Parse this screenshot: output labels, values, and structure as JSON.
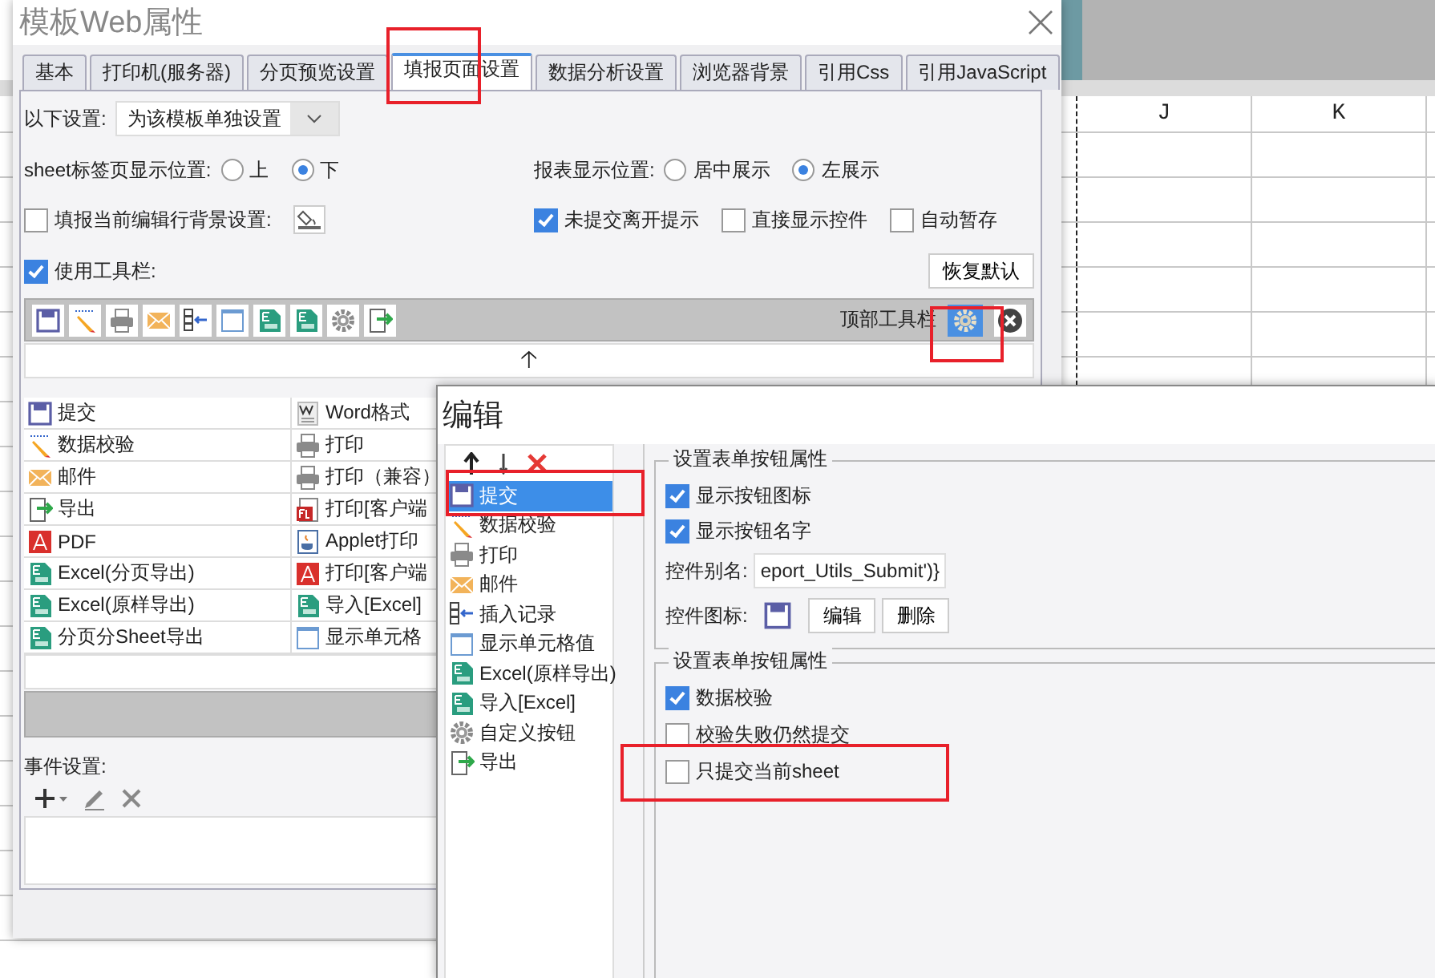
{
  "spreadsheet": {
    "columns": [
      "J",
      "K"
    ]
  },
  "main_dialog": {
    "title": "模板Web属性",
    "tabs": [
      {
        "label": "基本",
        "selected": false
      },
      {
        "label": "打印机(服务器)",
        "selected": false
      },
      {
        "label": "分页预览设置",
        "selected": false
      },
      {
        "label": "填报页面设置",
        "selected": true
      },
      {
        "label": "数据分析设置",
        "selected": false
      },
      {
        "label": "浏览器背景",
        "selected": false
      },
      {
        "label": "引用Css",
        "selected": false
      },
      {
        "label": "引用JavaScript",
        "selected": false
      }
    ],
    "scope": {
      "label": "以下设置:",
      "value": "为该模板单独设置"
    },
    "sheet_tab_position": {
      "label": "sheet标签页显示位置:",
      "options": [
        {
          "label": "上",
          "selected": false
        },
        {
          "label": "下",
          "selected": true
        }
      ]
    },
    "report_position": {
      "label": "报表显示位置:",
      "options": [
        {
          "label": "居中展示",
          "selected": false
        },
        {
          "label": "左展示",
          "selected": true
        }
      ]
    },
    "row_background": {
      "label": "填报当前编辑行背景设置:",
      "checked": false
    },
    "options": [
      {
        "label": "未提交离开提示",
        "checked": true
      },
      {
        "label": "直接显示控件",
        "checked": false
      },
      {
        "label": "自动暂存",
        "checked": false
      }
    ],
    "use_toolbar": {
      "label": "使用工具栏:",
      "checked": true
    },
    "restore_button": "恢复默认",
    "toolbar": {
      "icons": [
        {
          "kind": "save"
        },
        {
          "kind": "pencil"
        },
        {
          "kind": "print"
        },
        {
          "kind": "mail"
        },
        {
          "kind": "insert"
        },
        {
          "kind": "cell"
        },
        {
          "kind": "excel"
        },
        {
          "kind": "excel"
        },
        {
          "kind": "gear"
        },
        {
          "kind": "export"
        }
      ],
      "label": "顶部工具栏",
      "settings_selected": true
    },
    "arrow": "🡡",
    "buttons_left": [
      {
        "label": "提交",
        "kind": "save"
      },
      {
        "label": "数据校验",
        "kind": "pencil"
      },
      {
        "label": "邮件",
        "kind": "mail"
      },
      {
        "label": "导出",
        "kind": "export"
      },
      {
        "label": "PDF",
        "kind": "pdf"
      },
      {
        "label": "Excel(分页导出)",
        "kind": "excel"
      },
      {
        "label": "Excel(原样导出)",
        "kind": "excel"
      },
      {
        "label": "分页分Sheet导出",
        "kind": "excel"
      }
    ],
    "buttons_right": [
      {
        "label": "Word格式",
        "kind": "word"
      },
      {
        "label": "打印",
        "kind": "print"
      },
      {
        "label": "打印（兼容）",
        "kind": "print"
      },
      {
        "label": "打印[客户端",
        "kind": "flash"
      },
      {
        "label": "Applet打印",
        "kind": "applet"
      },
      {
        "label": "打印[客户端",
        "kind": "pdf"
      },
      {
        "label": "导入[Excel]",
        "kind": "excel"
      },
      {
        "label": "显示单元格",
        "kind": "cell"
      }
    ],
    "event_settings": "事件设置:"
  },
  "edit_dialog": {
    "title": "编辑",
    "list": [
      {
        "label": "提交",
        "kind": "save",
        "selected": true
      },
      {
        "label": "数据校验",
        "kind": "pencil",
        "selected": false
      },
      {
        "label": "打印",
        "kind": "print",
        "selected": false
      },
      {
        "label": "邮件",
        "kind": "mail",
        "selected": false
      },
      {
        "label": "插入记录",
        "kind": "insert",
        "selected": false
      },
      {
        "label": "显示单元格值",
        "kind": "cell",
        "selected": false
      },
      {
        "label": "Excel(原样导出)",
        "kind": "excel",
        "selected": false
      },
      {
        "label": "导入[Excel]",
        "kind": "excel",
        "selected": false
      },
      {
        "label": "自定义按钮",
        "kind": "gear",
        "selected": false
      },
      {
        "label": "导出",
        "kind": "export",
        "selected": false
      }
    ],
    "group_1": {
      "title": "设置表单按钮属性",
      "checkboxes": [
        {
          "label": "显示按钮图标",
          "checked": true
        },
        {
          "label": "显示按钮名字",
          "checked": true
        }
      ],
      "alias": {
        "label": "控件别名:",
        "value": "eport_Utils_Submit')}"
      },
      "icon_label": "控件图标:",
      "buttons": [
        "编辑",
        "删除"
      ]
    },
    "group_2": {
      "title": "设置表单按钮属性",
      "checkboxes": [
        {
          "label": "数据校验",
          "checked": true
        },
        {
          "label": "校验失败仍然提交",
          "checked": false
        },
        {
          "label": "只提交当前sheet",
          "checked": false
        }
      ]
    }
  }
}
